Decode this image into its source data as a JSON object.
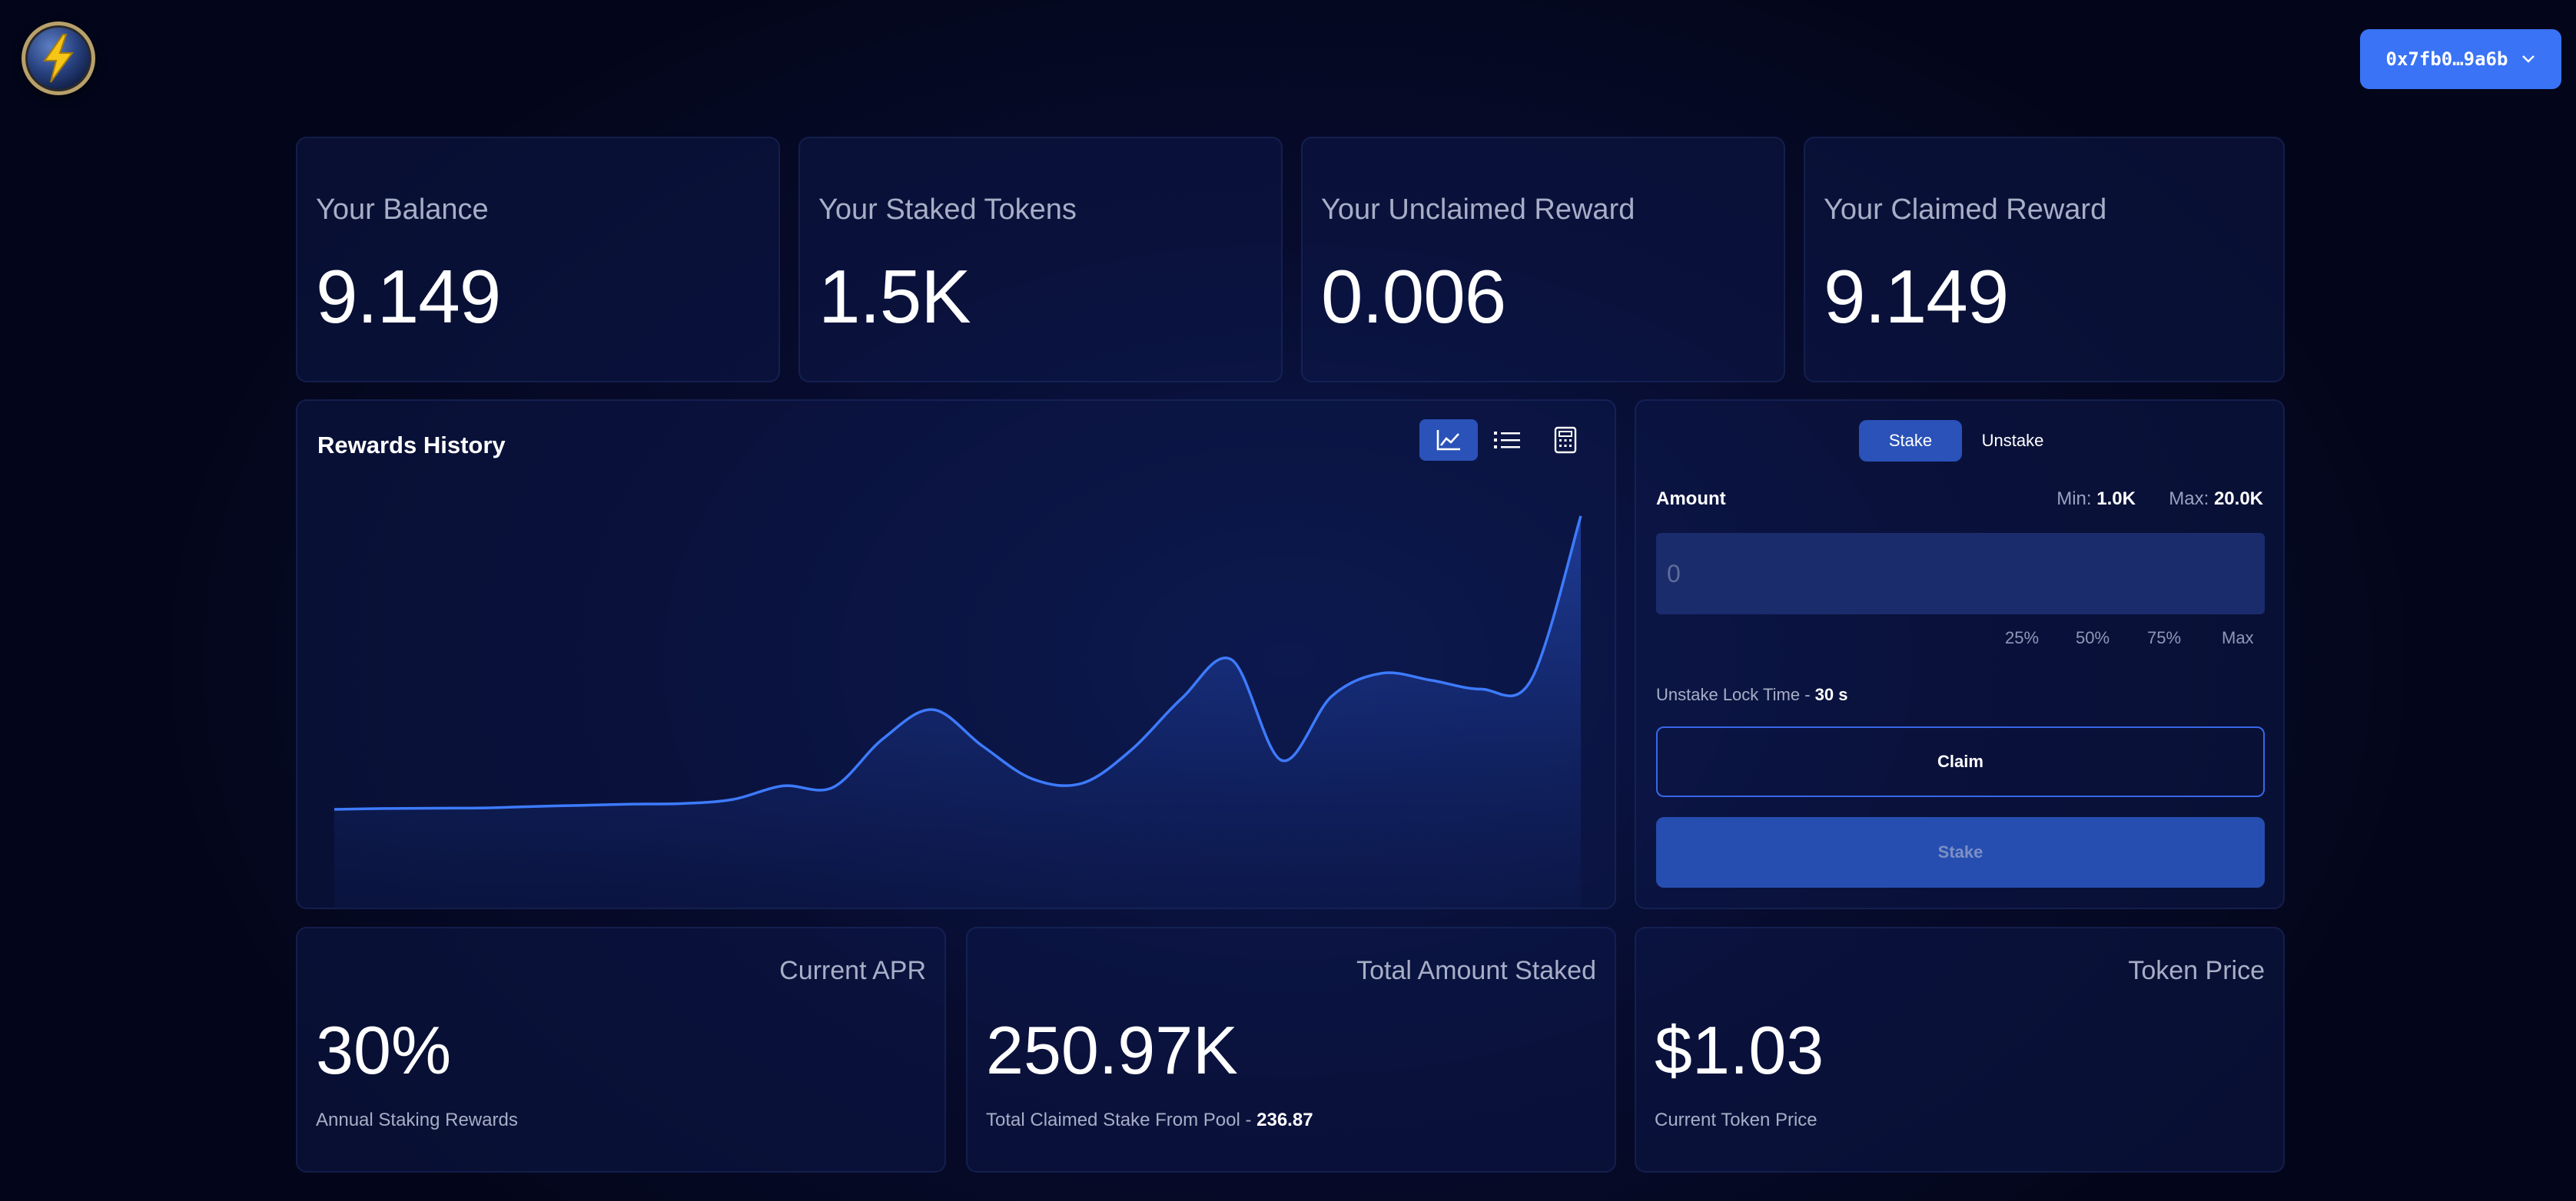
{
  "header": {
    "wallet_address": "0x7fb0…9a6b"
  },
  "stats": [
    {
      "label": "Your Balance",
      "value": "9.149"
    },
    {
      "label": "Your Staked Tokens",
      "value": "1.5K"
    },
    {
      "label": "Your Unclaimed Reward",
      "value": "0.006"
    },
    {
      "label": "Your Claimed Reward",
      "value": "9.149"
    }
  ],
  "rewards_history": {
    "title": "Rewards History",
    "views": [
      "chart-view",
      "list-view",
      "calculator-view"
    ],
    "active_view": "chart-view"
  },
  "chart_data": {
    "type": "area",
    "title": "",
    "xlabel": "",
    "ylabel": "",
    "ylim": [
      0,
      100
    ],
    "x": [
      0,
      4,
      8,
      12,
      16,
      20,
      24,
      28,
      32,
      36,
      40,
      44,
      48,
      52,
      56,
      60,
      64,
      68,
      72,
      76,
      80,
      84,
      88,
      92,
      96,
      100
    ],
    "series": [
      {
        "values": [
          0,
          0.3,
          0.4,
          0.5,
          1.0,
          1.4,
          1.8,
          2.0,
          3.4,
          8.0,
          7.5,
          24.0,
          34.0,
          21.6,
          10.4,
          8.9,
          20.5,
          37.9,
          51.0,
          16.7,
          38.5,
          46.4,
          44.0,
          41.0,
          44.0,
          100
        ]
      }
    ]
  },
  "stake_panel": {
    "tabs": {
      "stake": "Stake",
      "unstake": "Unstake"
    },
    "active_tab": "Stake",
    "amount_label": "Amount",
    "min_label": "Min:",
    "min_value": "1.0K",
    "max_label": "Max:",
    "max_value": "20.0K",
    "amount_placeholder": "0",
    "percent_buttons": [
      "25%",
      "50%",
      "75%",
      "Max"
    ],
    "lock_time_label": "Unstake Lock Time -",
    "lock_time_value": "30 s",
    "claim_label": "Claim",
    "stake_label": "Stake"
  },
  "bottom_stats": [
    {
      "title": "Current APR",
      "value": "30%",
      "subtitle": "Annual Staking Rewards",
      "subtitle_value": ""
    },
    {
      "title": "Total Amount Staked",
      "value": "250.97K",
      "subtitle": "Total Claimed Stake From Pool -",
      "subtitle_value": "236.87"
    },
    {
      "title": "Token Price",
      "value": "$1.03",
      "subtitle": "Current Token Price",
      "subtitle_value": ""
    }
  ],
  "colors": {
    "accent": "#3a73f5",
    "active_tab": "#2a52b8",
    "line": "#3d7bff",
    "background": "#070c2e"
  }
}
